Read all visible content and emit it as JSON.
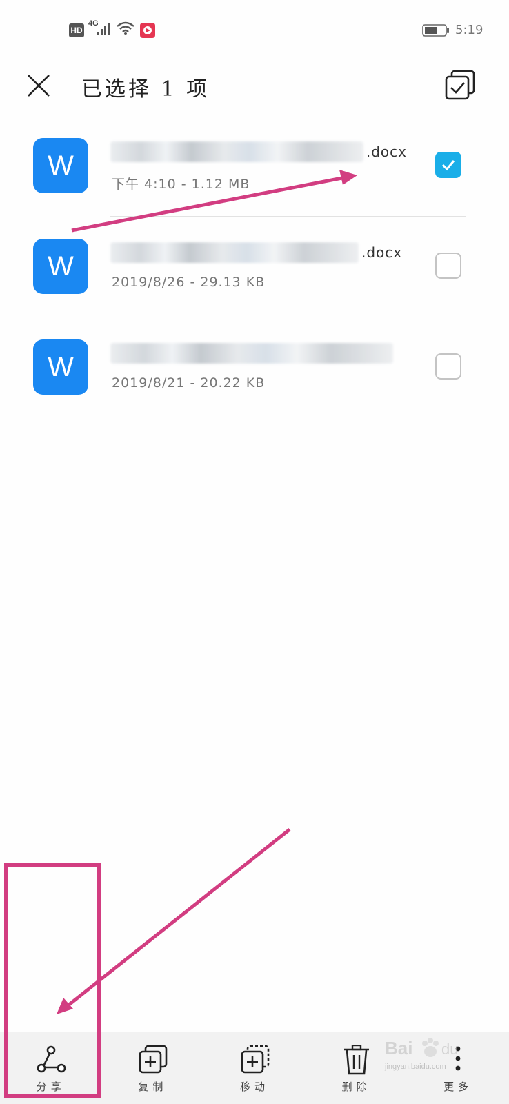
{
  "status_bar": {
    "hd": "HD",
    "network": "4G",
    "time": "5:19",
    "icons": [
      "hd-badge-icon",
      "signal-icon",
      "wifi-icon",
      "app-badge-icon",
      "battery-icon"
    ]
  },
  "header": {
    "title": "已选择 1 项",
    "close_icon": "close-icon",
    "select_all_icon": "select-all-icon"
  },
  "files": [
    {
      "icon_letter": "W",
      "ext": ".docx",
      "meta": "下午 4:10 - 1.12 MB",
      "checked": true
    },
    {
      "icon_letter": "W",
      "ext": ".docx",
      "meta": "2019/8/26 - 29.13 KB",
      "checked": false
    },
    {
      "icon_letter": "W",
      "ext": "",
      "meta": "2019/8/21 - 20.22 KB",
      "checked": false
    }
  ],
  "toolbar": {
    "share_label": "分享",
    "copy_label": "复制",
    "move_label": "移动",
    "delete_label": "删除",
    "more_label": "更多"
  },
  "watermark": {
    "text": "jingyan.baidu.com"
  },
  "colors": {
    "accent": "#1aaee8",
    "file_icon": "#1a88f2",
    "annotation": "#d23d81",
    "toolbar_bg": "#f2f2f2"
  }
}
